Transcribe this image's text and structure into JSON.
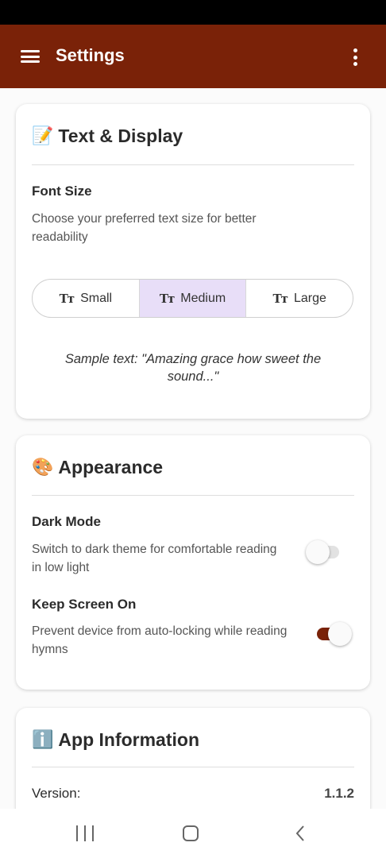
{
  "app_bar": {
    "title": "Settings"
  },
  "text_display": {
    "emoji": "📝",
    "title": "Text & Display",
    "font_size": {
      "title": "Font Size",
      "description": "Choose your preferred text size for better readability",
      "options": [
        {
          "icon": "Tт",
          "label": "Small",
          "selected": false
        },
        {
          "icon": "Tт",
          "label": "Medium",
          "selected": true
        },
        {
          "icon": "Tт",
          "label": "Large",
          "selected": false
        }
      ],
      "sample": "Sample text: \"Amazing grace how sweet the sound...\""
    }
  },
  "appearance": {
    "emoji": "🎨",
    "title": "Appearance",
    "dark_mode": {
      "title": "Dark Mode",
      "description": "Switch to dark theme for comfortable reading in low light",
      "enabled": false
    },
    "keep_screen_on": {
      "title": "Keep Screen On",
      "description": "Prevent device from auto-locking while reading hymns",
      "enabled": true
    }
  },
  "app_information": {
    "emoji": "ℹ️",
    "title": "App Information",
    "version_label": "Version:",
    "version_value": "1.1.2"
  },
  "colors": {
    "primary": "#7a2208",
    "selected_segment": "#e8def8",
    "toggle_off_track": "#e0e0e0"
  }
}
